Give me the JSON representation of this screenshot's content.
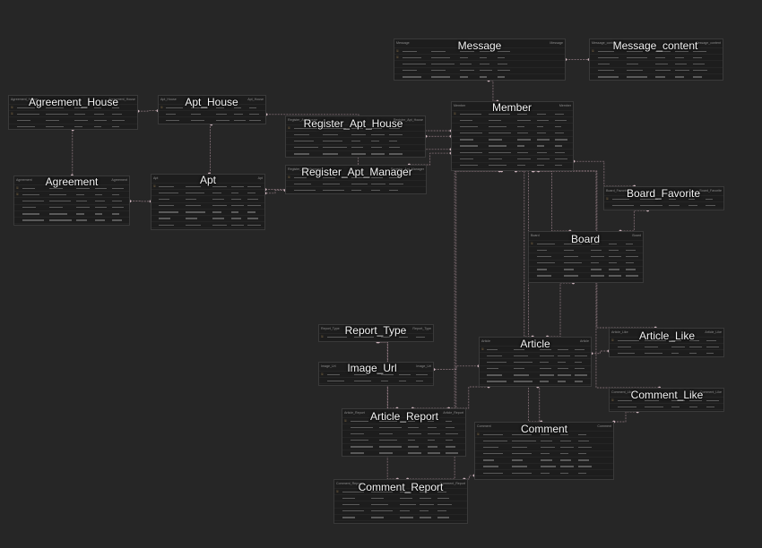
{
  "diagram": {
    "tables": [
      {
        "id": "Message",
        "title": "Message",
        "header_left": "Message",
        "header_right": "Message",
        "rows": 5,
        "pk": 2
      },
      {
        "id": "Message_content",
        "title": "Message_content",
        "header_left": "Message_content",
        "header_right": "Message_content",
        "rows": 5,
        "pk": 1
      },
      {
        "id": "Agreement_House",
        "title": "Agreement_House",
        "header_left": "Agreement_House",
        "header_right": "Agreement_House",
        "rows": 4,
        "pk": 2
      },
      {
        "id": "Apt_House",
        "title": "Apt_House",
        "header_left": "Apt_House",
        "header_right": "Apt_House",
        "rows": 3,
        "pk": 1
      },
      {
        "id": "Member",
        "title": "Member",
        "header_left": "Member",
        "header_right": "Member",
        "rows": 11,
        "pk": 1
      },
      {
        "id": "Register_Apt_House",
        "title": "Register_Apt_House",
        "header_left": "Register_Apt_House",
        "header_right": "Register_Apt_House",
        "rows": 5,
        "pk": 1
      },
      {
        "id": "Register_Apt_Manager",
        "title": "Register_Apt_Manager",
        "header_left": "Register_Apt_Manager",
        "header_right": "Register_Apt_Manager",
        "rows": 3,
        "pk": 1
      },
      {
        "id": "Agreement",
        "title": "Agreement",
        "header_left": "Agreement",
        "header_right": "Agreement",
        "rows": 7,
        "pk": 2
      },
      {
        "id": "Apt",
        "title": "Apt",
        "header_left": "Apt",
        "header_right": "Apt",
        "rows": 8,
        "pk": 1
      },
      {
        "id": "Board_Favorite",
        "title": "Board_Favorite",
        "header_left": "Board_Favorite",
        "header_right": "Board_Favorite",
        "rows": 3,
        "pk": 1
      },
      {
        "id": "Board",
        "title": "Board",
        "header_left": "Board",
        "header_right": "Board",
        "rows": 8,
        "pk": 1
      },
      {
        "id": "Report_Type",
        "title": "Report_Type",
        "header_left": "Report_Type",
        "header_right": "Report_Type",
        "rows": 1,
        "pk": 1
      },
      {
        "id": "Article_Like",
        "title": "Article_Like",
        "header_left": "Article_Like",
        "header_right": "Article_Like",
        "rows": 3,
        "pk": 1
      },
      {
        "id": "Article",
        "title": "Article",
        "header_left": "Article",
        "header_right": "Article",
        "rows": 8,
        "pk": 1
      },
      {
        "id": "Image_Url",
        "title": "Image_Url",
        "header_left": "Image_Url",
        "header_right": "Image_Url",
        "rows": 3,
        "pk": 1
      },
      {
        "id": "Comment_Like",
        "title": "Comment_Like",
        "header_left": "Comment_Like",
        "header_right": "Comment_Like",
        "rows": 3,
        "pk": 1
      },
      {
        "id": "Article_Report",
        "title": "Article_Report",
        "header_left": "Article_Report",
        "header_right": "Article_Report",
        "rows": 7,
        "pk": 1
      },
      {
        "id": "Comment",
        "title": "Comment",
        "header_left": "Comment",
        "header_right": "Comment",
        "rows": 9,
        "pk": 1
      },
      {
        "id": "Comment_Report",
        "title": "Comment_Report",
        "header_left": "Comment_Report",
        "header_right": "Comment_Report",
        "rows": 7,
        "pk": 1
      }
    ],
    "relations": [
      [
        "Message",
        "Member"
      ],
      [
        "Message",
        "Message_content"
      ],
      [
        "Agreement_House",
        "Apt_House"
      ],
      [
        "Agreement_House",
        "Agreement"
      ],
      [
        "Apt_House",
        "Member"
      ],
      [
        "Apt_House",
        "Apt"
      ],
      [
        "Register_Apt_House",
        "Member"
      ],
      [
        "Register_Apt_Manager",
        "Member"
      ],
      [
        "Register_Apt_Manager",
        "Apt"
      ],
      [
        "Agreement",
        "Apt"
      ],
      [
        "Apt",
        "Member"
      ],
      [
        "Member",
        "Board_Favorite"
      ],
      [
        "Board_Favorite",
        "Board"
      ],
      [
        "Member",
        "Board"
      ],
      [
        "Member",
        "Article"
      ],
      [
        "Member",
        "Comment"
      ],
      [
        "Member",
        "Article_Report"
      ],
      [
        "Member",
        "Comment_Report"
      ],
      [
        "Member",
        "Article_Like"
      ],
      [
        "Member",
        "Comment_Like"
      ],
      [
        "Board",
        "Article"
      ],
      [
        "Article",
        "Article_Like"
      ],
      [
        "Article",
        "Comment"
      ],
      [
        "Article",
        "Image_Url"
      ],
      [
        "Article",
        "Article_Report"
      ],
      [
        "Comment",
        "Comment_Like"
      ],
      [
        "Comment",
        "Comment_Report"
      ],
      [
        "Report_Type",
        "Article_Report"
      ],
      [
        "Report_Type",
        "Comment_Report"
      ]
    ]
  }
}
